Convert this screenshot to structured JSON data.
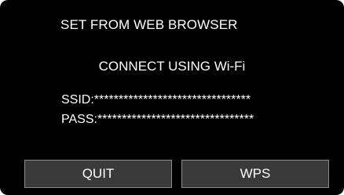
{
  "screen": {
    "title": "SET FROM WEB BROWSER",
    "subtitle": "CONNECT USING Wi-Fi",
    "ssid_label": "SSID:",
    "ssid_value": "********************************",
    "pass_label": "PASS:",
    "pass_value": "********************************"
  },
  "buttons": {
    "quit_label": "QUIT",
    "wps_label": "WPS"
  },
  "colors": {
    "background": "#000000",
    "text": "#ffffff",
    "button_fill": "#3a3a3a",
    "button_border": "#8a8a8a"
  }
}
